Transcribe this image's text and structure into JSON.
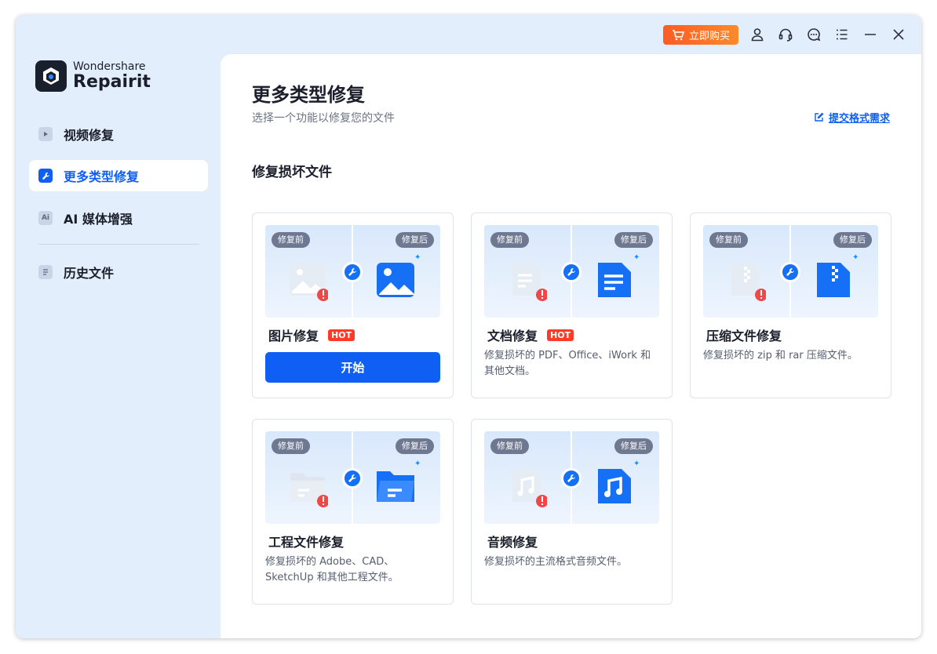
{
  "titlebar": {
    "buy_label": "立即购买"
  },
  "brand": {
    "line1": "Wondershare",
    "line2": "Repairit"
  },
  "sidebar": {
    "items": [
      {
        "label": "视频修复",
        "icon": "video-icon",
        "active": false
      },
      {
        "label": "更多类型修复",
        "icon": "wrench-icon",
        "active": true
      },
      {
        "label": "AI 媒体增强",
        "icon": "ai-icon",
        "active": false
      },
      {
        "label": "历史文件",
        "icon": "history-icon",
        "active": false
      }
    ],
    "ai_badge": "Ai"
  },
  "main": {
    "title": "更多类型修复",
    "subtitle": "选择一个功能以修复您的文件",
    "submit_link": "提交格式需求",
    "section_title": "修复损坏文件",
    "before_label": "修复前",
    "after_label": "修复后",
    "cards": [
      {
        "title": "图片修复",
        "hot": "HOT",
        "button": "开始",
        "icon": "image-icon"
      },
      {
        "title": "文档修复",
        "hot": "HOT",
        "desc": "修复损坏的 PDF、Office、iWork 和其他文档。",
        "icon": "document-icon"
      },
      {
        "title": "压缩文件修复",
        "desc": "修复损坏的 zip 和 rar 压缩文件。",
        "icon": "zip-icon"
      },
      {
        "title": "工程文件修复",
        "desc": "修复损坏的 Adobe、CAD、SketchUp 和其他工程文件。",
        "icon": "folder-icon"
      },
      {
        "title": "音频修复",
        "desc": "修复损坏的主流格式音频文件。",
        "icon": "music-icon"
      }
    ]
  },
  "colors": {
    "accent": "#0f5ff5",
    "buy_orange": "#ff6a25",
    "hot_red": "#ff3b28",
    "sidebar_bg": "#e3eefc"
  }
}
